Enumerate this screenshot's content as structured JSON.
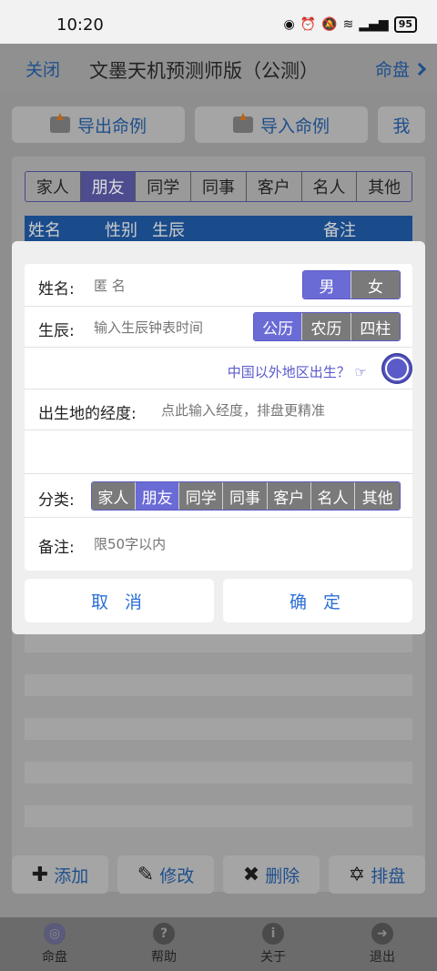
{
  "status": {
    "time": "10:20",
    "battery": "95"
  },
  "header": {
    "close_label": "关闭",
    "title": "文墨天机预测师版（公测）",
    "chart_label": "命盘"
  },
  "actions": {
    "export": "导出命例",
    "import": "导入命例",
    "me": "我"
  },
  "categories": [
    "家人",
    "朋友",
    "同学",
    "同事",
    "客户",
    "名人",
    "其他"
  ],
  "selected_category": "朋友",
  "table_headers": [
    "姓名",
    "性别",
    "生辰",
    "备注"
  ],
  "dialog": {
    "name_label": "姓名:",
    "name_placeholder": "匿 名",
    "gender_options": [
      "男",
      "女"
    ],
    "birth_label": "生辰:",
    "birth_placeholder": "输入生辰钟表时间",
    "calendar_options": [
      "公历",
      "农历",
      "四柱"
    ],
    "abroad_link": "中国以外地区出生？ ☞",
    "longitude_label": "出生地的经度:",
    "longitude_placeholder": "点此输入经度，排盘更精准",
    "category_label": "分类:",
    "note_label": "备注:",
    "note_placeholder": "限50字以内",
    "cancel": "取 消",
    "confirm": "确 定"
  },
  "bottom_buttons": {
    "add": "添加",
    "edit": "修改",
    "delete": "删除",
    "arrange": "排盘"
  },
  "tabs": [
    "命盘",
    "帮助",
    "关于",
    "退出"
  ]
}
